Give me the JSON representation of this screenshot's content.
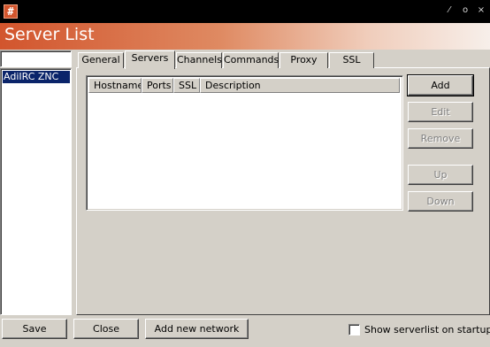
{
  "window": {
    "app_icon": "#",
    "controls": {
      "minimize": "⁄",
      "maximize": "o",
      "close": "×"
    }
  },
  "header": {
    "title": "Server List"
  },
  "networks": {
    "filter_value": "",
    "items": [
      {
        "label": "AdiIRC ZNC",
        "selected": true
      }
    ]
  },
  "tabs": [
    {
      "label": "General"
    },
    {
      "label": "Servers",
      "active": true
    },
    {
      "label": "Channels"
    },
    {
      "label": "Commands"
    },
    {
      "label": "Proxy"
    },
    {
      "label": "SSL"
    }
  ],
  "servers_table": {
    "columns": [
      "Hostname",
      "Ports",
      "SSL",
      "Description"
    ],
    "rows": []
  },
  "side_buttons": {
    "add": "Add",
    "edit": "Edit",
    "remove": "Remove",
    "up": "Up",
    "down": "Down"
  },
  "footer": {
    "save": "Save",
    "close": "Close",
    "add_network": "Add new network",
    "show_on_startup_label": "Show serverlist on startup",
    "show_on_startup_checked": false
  }
}
